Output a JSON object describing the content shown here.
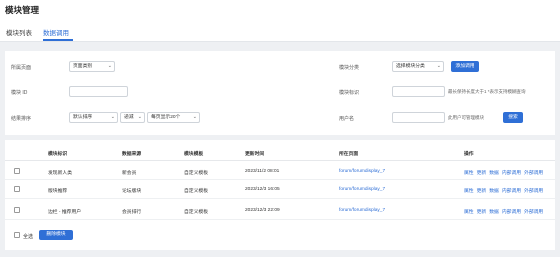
{
  "header": {
    "title": "模块管理",
    "tabs": [
      {
        "label": "模块列表"
      },
      {
        "label": "数据调用"
      }
    ]
  },
  "filter": {
    "page_label": "所属页面",
    "page_value": "页面类别",
    "category_label": "模块分类",
    "category_value": "选择模块分类",
    "add_call_button": "添加调用",
    "module_id_label": "模块 ID",
    "module_id_value": "",
    "module_name_label": "模块标识",
    "module_name_value": "",
    "module_name_hint": "最长保持长度大于1 *表示支持模糊查询",
    "sort_label": "结果排序",
    "sort_value": "默认排序",
    "order_value": "递减",
    "per_page_value": "每页显示20个",
    "username_label": "用户名",
    "username_value": "",
    "username_hint": "此用户可管理模块",
    "search_button": "搜索"
  },
  "table": {
    "columns": [
      "模块标识",
      "数据来源",
      "模块模板",
      "更新时间",
      "所在页面",
      "操作"
    ],
    "rows": [
      {
        "name": "发现新人类",
        "source": "新会员",
        "template": "自定义模板",
        "updated": "2023/11/2 08:01",
        "page": "forum/forumdisplay_7"
      },
      {
        "name": "版块推荐",
        "source": "论坛版块",
        "template": "自定义模板",
        "updated": "2023/12/3 16:05",
        "page": "forum/forumdisplay_7"
      },
      {
        "name": "边栏 - 推荐用户",
        "source": "会员排行",
        "template": "自定义模板",
        "updated": "2023/12/3 22:09",
        "page": "forum/forumdisplay_7"
      }
    ],
    "ops": [
      "属性",
      "更新",
      "数据",
      "内部调用",
      "外部调用"
    ],
    "select_all_label": "全选",
    "delete_button": "删除模块"
  }
}
